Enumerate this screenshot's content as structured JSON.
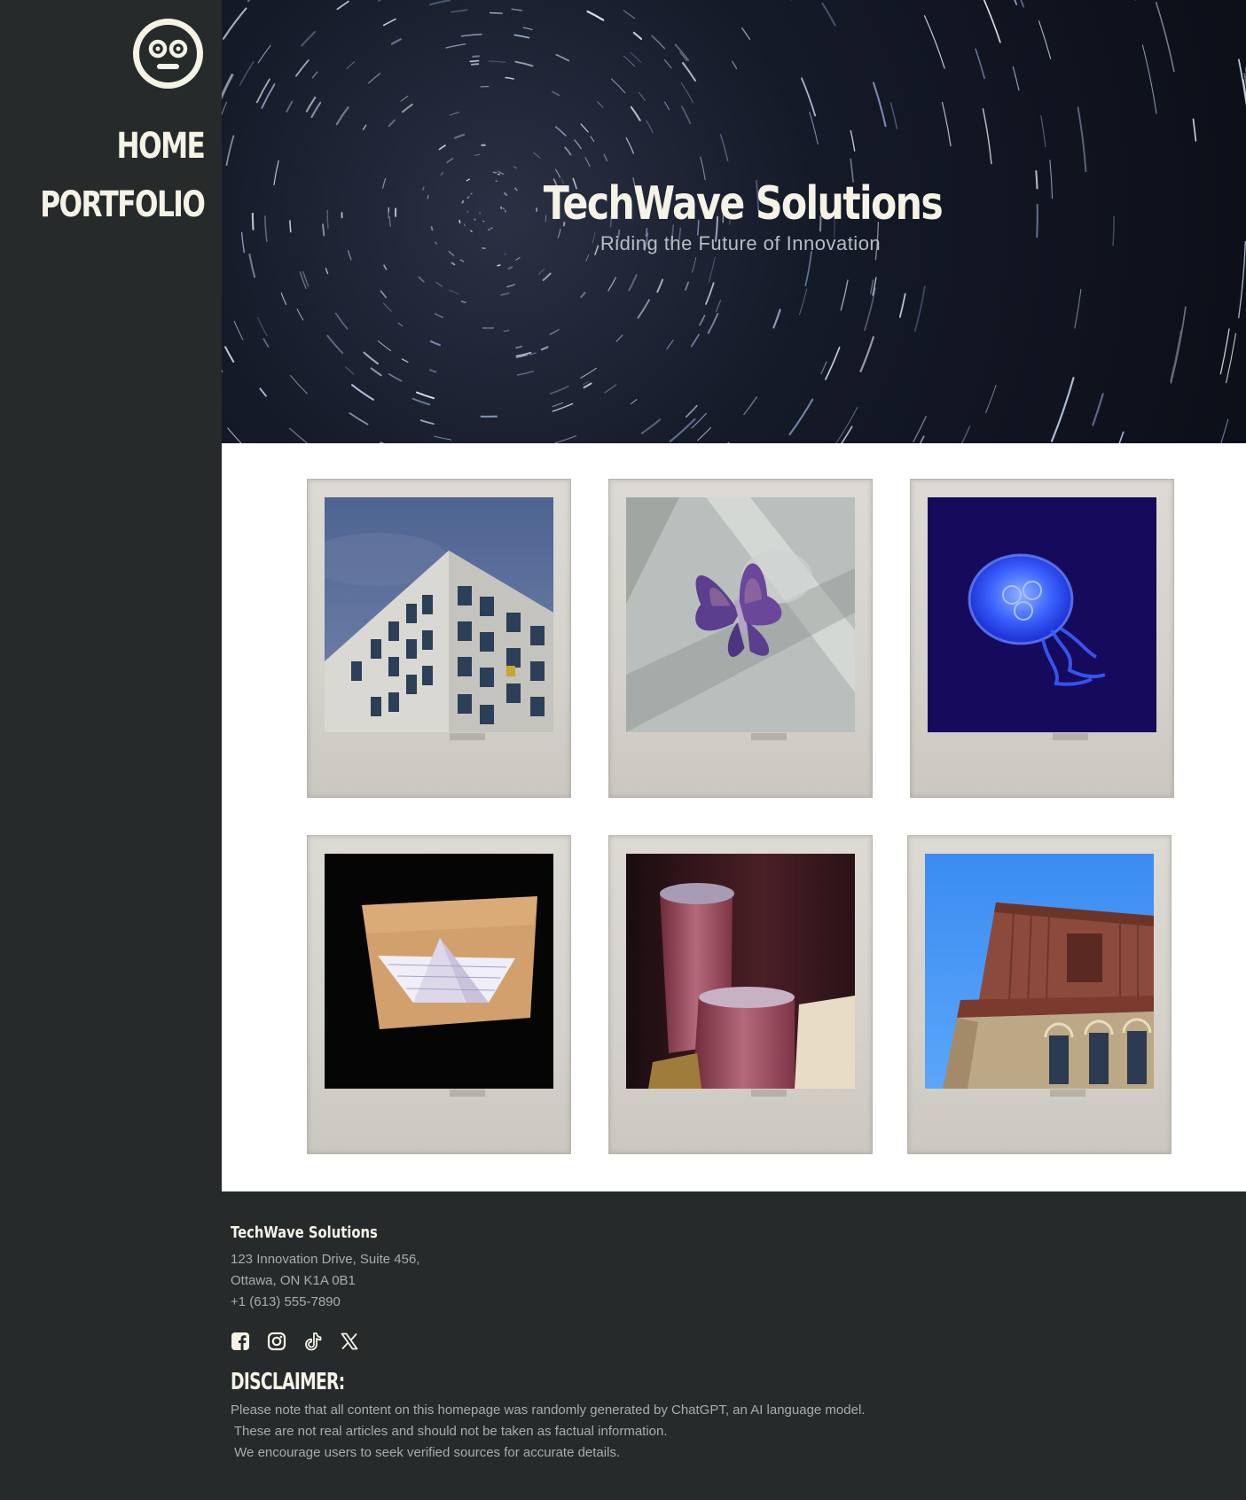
{
  "sidebar": {
    "logo_icon": "face-icon",
    "nav": [
      {
        "label": "HOME"
      },
      {
        "label": "PORTFOLIO"
      }
    ]
  },
  "hero": {
    "title": "TechWave Solutions",
    "subtitle": "Riding the Future of Innovation",
    "background": "star-trails-night-sky"
  },
  "gallery": {
    "items": [
      {
        "subject": "office-building-corner"
      },
      {
        "subject": "purple-butterfly"
      },
      {
        "subject": "blue-jellyfish"
      },
      {
        "subject": "paper-boat"
      },
      {
        "subject": "pink-crystal"
      },
      {
        "subject": "brick-building-tower"
      }
    ]
  },
  "footer": {
    "brand": "TechWave Solutions",
    "address_line1": "123 Innovation Drive, Suite 456,",
    "address_line2": "Ottawa, ON K1A 0B1",
    "phone": "+1 (613) 555-7890",
    "socials": [
      {
        "icon": "facebook-icon"
      },
      {
        "icon": "instagram-icon"
      },
      {
        "icon": "tiktok-icon"
      },
      {
        "icon": "x-icon"
      }
    ],
    "disclaimer_title": "DISCLAIMER:",
    "disclaimer_lines": [
      "Please note that all content on this homepage was randomly generated by ChatGPT, an AI language model.",
      " These are not real articles and should not be taken as factual information.",
      " We encourage users to seek verified sources for accurate details."
    ]
  },
  "colors": {
    "dark_bg": "#262a2b",
    "cream": "#f5f2e6",
    "muted_text": "#a9acb0",
    "polaroid": "#d8d6cf"
  }
}
